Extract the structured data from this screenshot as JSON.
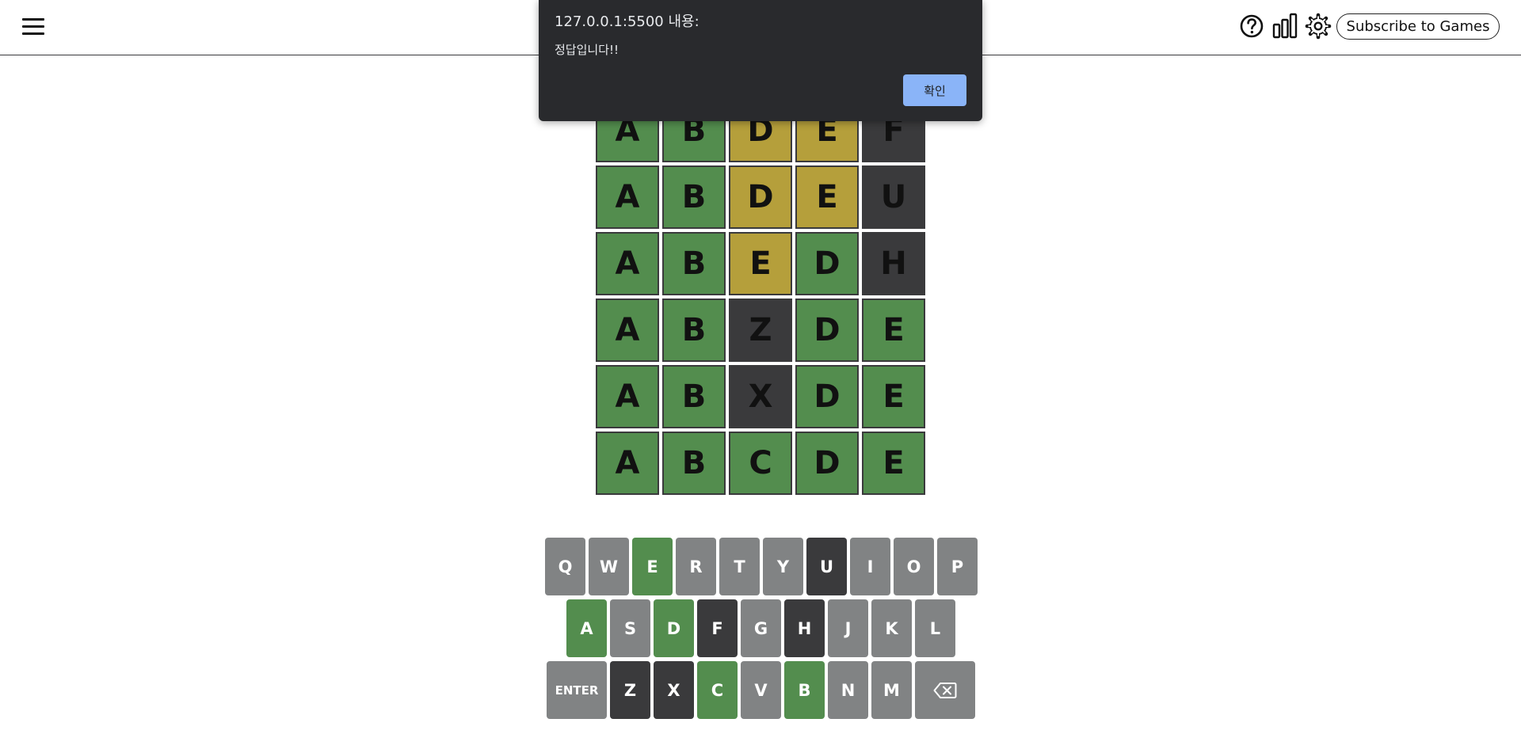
{
  "header": {
    "menu_icon": "hamburger-menu-icon",
    "help_icon": "question-circle-icon",
    "stats_icon": "bar-chart-icon",
    "settings_icon": "gear-icon",
    "subscribe_label": "Subscribe to Games"
  },
  "board": {
    "rows": [
      {
        "letters": [
          "A",
          "B",
          "D",
          "E",
          "F"
        ],
        "states": [
          "correct",
          "correct",
          "present",
          "present",
          "absent"
        ]
      },
      {
        "letters": [
          "A",
          "B",
          "D",
          "E",
          "U"
        ],
        "states": [
          "correct",
          "correct",
          "present",
          "present",
          "absent"
        ]
      },
      {
        "letters": [
          "A",
          "B",
          "E",
          "D",
          "H"
        ],
        "states": [
          "correct",
          "correct",
          "present",
          "correct",
          "absent"
        ]
      },
      {
        "letters": [
          "A",
          "B",
          "Z",
          "D",
          "E"
        ],
        "states": [
          "correct",
          "correct",
          "absent",
          "correct",
          "correct"
        ]
      },
      {
        "letters": [
          "A",
          "B",
          "X",
          "D",
          "E"
        ],
        "states": [
          "correct",
          "correct",
          "absent",
          "correct",
          "correct"
        ]
      },
      {
        "letters": [
          "A",
          "B",
          "C",
          "D",
          "E"
        ],
        "states": [
          "correct",
          "correct",
          "correct",
          "correct",
          "correct"
        ]
      }
    ]
  },
  "keyboard": {
    "rows": [
      [
        {
          "label": "Q",
          "state": "unused"
        },
        {
          "label": "W",
          "state": "unused"
        },
        {
          "label": "E",
          "state": "correct"
        },
        {
          "label": "R",
          "state": "unused"
        },
        {
          "label": "T",
          "state": "unused"
        },
        {
          "label": "Y",
          "state": "unused"
        },
        {
          "label": "U",
          "state": "absent"
        },
        {
          "label": "I",
          "state": "unused"
        },
        {
          "label": "O",
          "state": "unused"
        },
        {
          "label": "P",
          "state": "unused"
        }
      ],
      [
        {
          "label": "A",
          "state": "correct"
        },
        {
          "label": "S",
          "state": "unused"
        },
        {
          "label": "D",
          "state": "correct"
        },
        {
          "label": "F",
          "state": "absent"
        },
        {
          "label": "G",
          "state": "unused"
        },
        {
          "label": "H",
          "state": "absent"
        },
        {
          "label": "J",
          "state": "unused"
        },
        {
          "label": "K",
          "state": "unused"
        },
        {
          "label": "L",
          "state": "unused"
        }
      ],
      [
        {
          "label": "ENTER",
          "state": "unused",
          "kind": "enter"
        },
        {
          "label": "Z",
          "state": "absent"
        },
        {
          "label": "X",
          "state": "absent"
        },
        {
          "label": "C",
          "state": "correct"
        },
        {
          "label": "V",
          "state": "unused"
        },
        {
          "label": "B",
          "state": "correct"
        },
        {
          "label": "N",
          "state": "unused"
        },
        {
          "label": "M",
          "state": "unused"
        },
        {
          "label": "",
          "state": "unused",
          "kind": "backspace",
          "icon": "backspace-icon"
        }
      ]
    ]
  },
  "colors": {
    "correct": "#538d4e",
    "present": "#b59f3b",
    "absent": "#3a3a3c",
    "unused": "#818384"
  },
  "dialog": {
    "title": "127.0.0.1:5500 내용:",
    "message": "정답입니다!!",
    "ok_label": "확인"
  }
}
